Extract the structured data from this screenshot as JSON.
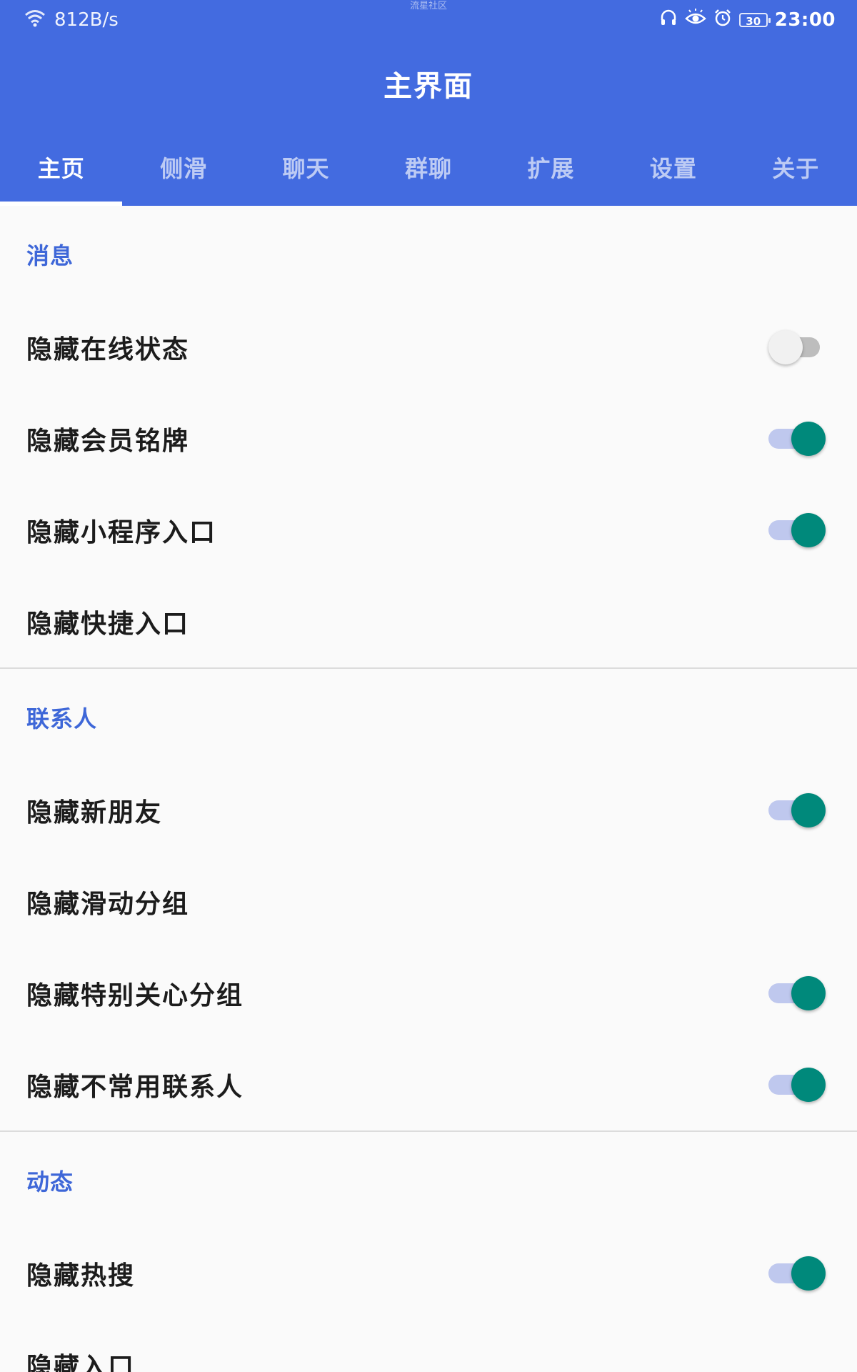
{
  "status_bar": {
    "net_speed": "812B/s",
    "center_text": "流星社区",
    "battery": "30",
    "time": "23:00"
  },
  "header": {
    "title": "主界面"
  },
  "tabs": [
    {
      "label": "主页",
      "active": true
    },
    {
      "label": "侧滑",
      "active": false
    },
    {
      "label": "聊天",
      "active": false
    },
    {
      "label": "群聊",
      "active": false
    },
    {
      "label": "扩展",
      "active": false
    },
    {
      "label": "设置",
      "active": false
    },
    {
      "label": "关于",
      "active": false
    }
  ],
  "sections": [
    {
      "title": "消息",
      "items": [
        {
          "label": "隐藏在线状态",
          "switch": "off"
        },
        {
          "label": "隐藏会员铭牌",
          "switch": "on"
        },
        {
          "label": "隐藏小程序入口",
          "switch": "on"
        },
        {
          "label": "隐藏快捷入口",
          "switch": "none"
        }
      ]
    },
    {
      "title": "联系人",
      "items": [
        {
          "label": "隐藏新朋友",
          "switch": "on"
        },
        {
          "label": "隐藏滑动分组",
          "switch": "none"
        },
        {
          "label": "隐藏特别关心分组",
          "switch": "on"
        },
        {
          "label": "隐藏不常用联系人",
          "switch": "on"
        }
      ]
    },
    {
      "title": "动态",
      "items": [
        {
          "label": "隐藏热搜",
          "switch": "on"
        },
        {
          "label": "隐藏入口",
          "switch": "none"
        }
      ]
    }
  ],
  "colors": {
    "header_bg": "#436BE0",
    "section_title": "#3E67D8",
    "switch_on_thumb": "#00897B",
    "switch_on_track": "#BFC8EE"
  }
}
